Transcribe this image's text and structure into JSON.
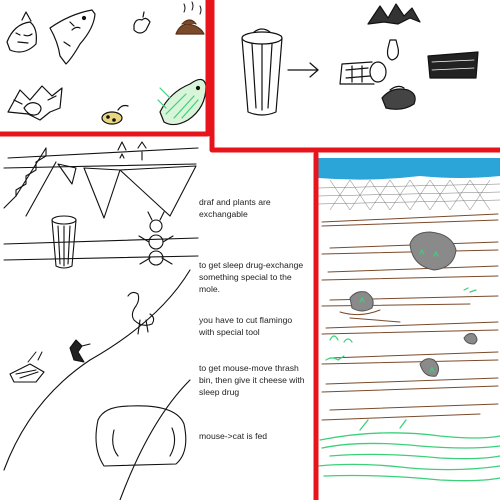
{
  "notes": [
    "draf and plants are exchangable",
    "to get sleep drug-exchange something special to the mole.",
    "you have to cut flamingo with special tool",
    "to get mouse-move thrash bin, then give it cheese with sleep drug",
    "mouse->cat is fed"
  ],
  "colors": {
    "frame_red": "#e8141c",
    "sky_blue": "#2ba4d8",
    "mud_brown": "#7a4a2a",
    "grass_green": "#3cd07a",
    "rock_grey": "#8a8a8a",
    "ink": "#111111"
  }
}
